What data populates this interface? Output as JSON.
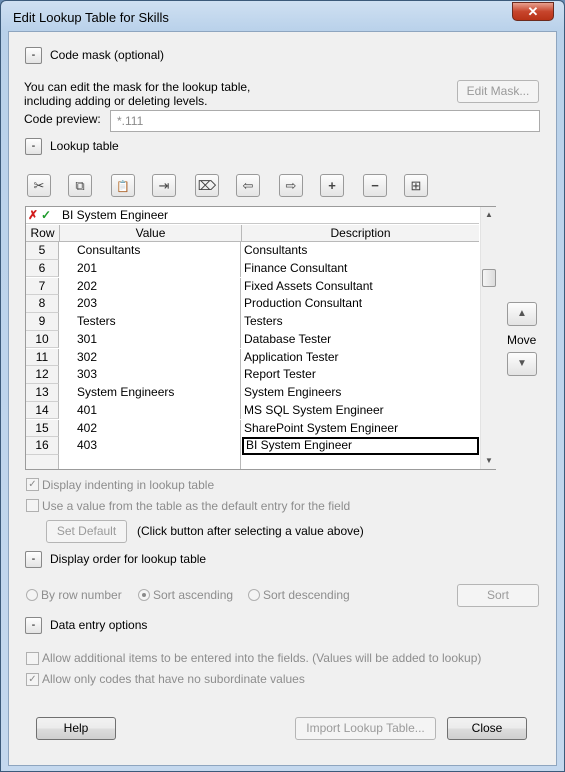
{
  "window": {
    "title": "Edit Lookup Table for Skills",
    "close_glyph": "✕"
  },
  "code_mask": {
    "section_label": "Code mask (optional)",
    "toggle": "-",
    "info_line1": "You can edit the mask for the lookup table,",
    "info_line2": "including adding or deleting levels.",
    "edit_mask_button": "Edit Mask...",
    "preview_label": "Code preview:",
    "preview_value": "*.111"
  },
  "lookup": {
    "section_label": "Lookup table",
    "toggle": "-",
    "toolbar": [
      {
        "name": "cut-icon",
        "glyph": "✂"
      },
      {
        "name": "copy-icon",
        "glyph": "⧉"
      },
      {
        "name": "paste-icon",
        "glyph": "📋"
      },
      {
        "name": "insert-row-icon",
        "glyph": "⇥"
      },
      {
        "name": "delete-row-icon",
        "glyph": "⌦"
      },
      {
        "name": "outdent-icon",
        "glyph": "⇦"
      },
      {
        "name": "indent-icon",
        "glyph": "⇨"
      },
      {
        "name": "expand-icon",
        "glyph": "+"
      },
      {
        "name": "collapse-icon",
        "glyph": "−"
      },
      {
        "name": "expand-all-icon",
        "glyph": "⊞"
      }
    ],
    "edit_cancel_glyph": "✗",
    "edit_accept_glyph": "✓",
    "edit_value": "BI System Engineer",
    "columns": [
      "Row",
      "Value",
      "Description"
    ],
    "rows": [
      {
        "row": "5",
        "value": "Consultants",
        "description": "Consultants"
      },
      {
        "row": "6",
        "value": "201",
        "description": "Finance Consultant"
      },
      {
        "row": "7",
        "value": "202",
        "description": "Fixed Assets Consultant"
      },
      {
        "row": "8",
        "value": "203",
        "description": "Production Consultant"
      },
      {
        "row": "9",
        "value": "Testers",
        "description": "Testers"
      },
      {
        "row": "10",
        "value": "301",
        "description": "Database Tester"
      },
      {
        "row": "11",
        "value": "302",
        "description": "Application Tester"
      },
      {
        "row": "12",
        "value": "303",
        "description": "Report Tester"
      },
      {
        "row": "13",
        "value": "System Engineers",
        "description": "System Engineers"
      },
      {
        "row": "14",
        "value": "401",
        "description": "MS SQL  System Engineer"
      },
      {
        "row": "15",
        "value": "402",
        "description": "SharePoint System Engineer"
      },
      {
        "row": "16",
        "value": "403",
        "description": "BI System Engineer"
      }
    ],
    "move_label": "Move",
    "move_up_glyph": "▲",
    "move_down_glyph": "▼",
    "display_indenting": "Display indenting in lookup table",
    "display_indenting_checked": true,
    "use_default": "Use a value from the table as the default entry for the field",
    "use_default_checked": false,
    "set_default_button": "Set Default",
    "set_default_hint": "(Click button after selecting a value above)"
  },
  "display_order": {
    "section_label": "Display order for lookup table",
    "toggle": "-",
    "by_row": "By row number",
    "sort_asc": "Sort ascending",
    "sort_desc": "Sort descending",
    "selected": "Sort ascending",
    "sort_button": "Sort"
  },
  "data_entry": {
    "section_label": "Data entry options",
    "toggle": "-",
    "allow_additional": "Allow additional items to be entered into the fields. (Values will be added to lookup)",
    "allow_additional_checked": false,
    "allow_only_codes": "Allow only codes that have no subordinate values",
    "allow_only_codes_checked": true
  },
  "footer": {
    "help": "Help",
    "import": "Import Lookup Table...",
    "close": "Close"
  }
}
